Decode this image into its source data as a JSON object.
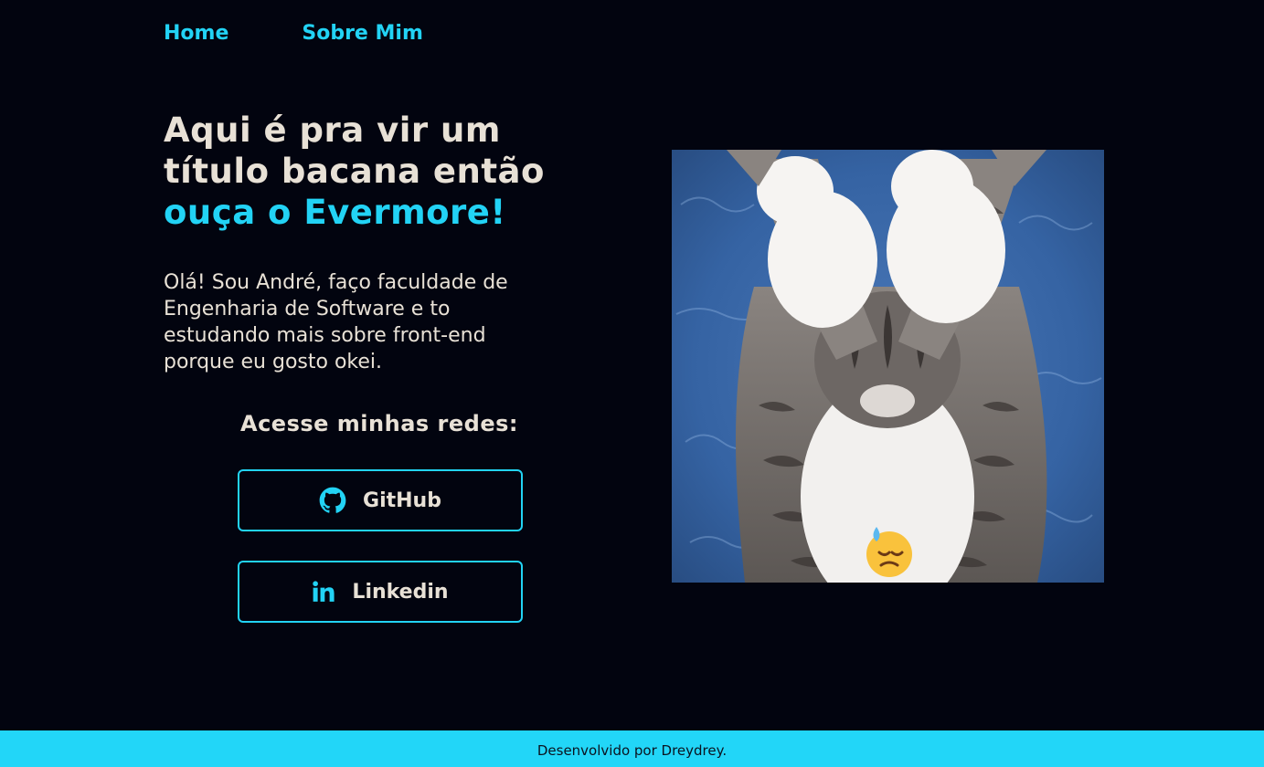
{
  "nav": {
    "items": [
      {
        "label": "Home"
      },
      {
        "label": "Sobre Mim"
      }
    ]
  },
  "hero": {
    "title_line1": "Aqui é pra vir um",
    "title_line2": "título bacana então",
    "title_accent": "ouça o Evermore!",
    "intro": "Olá! Sou André, faço faculdade de Engenharia de Software e to estudando mais sobre front-end porque eu gosto okei."
  },
  "social": {
    "heading": "Acesse minhas redes:",
    "buttons": [
      {
        "label": "GitHub",
        "icon": "github-icon"
      },
      {
        "label": "Linkedin",
        "icon": "linkedin-icon"
      }
    ]
  },
  "image": {
    "subject": "kitten-covering-eyes",
    "emoji": "😓"
  },
  "footer": {
    "text": "Desenvolvido por Dreydrey."
  },
  "colors": {
    "background": "#02040f",
    "accent": "#22d3f5",
    "text": "#e8e1d6",
    "footer_bg": "#22d6f8"
  }
}
